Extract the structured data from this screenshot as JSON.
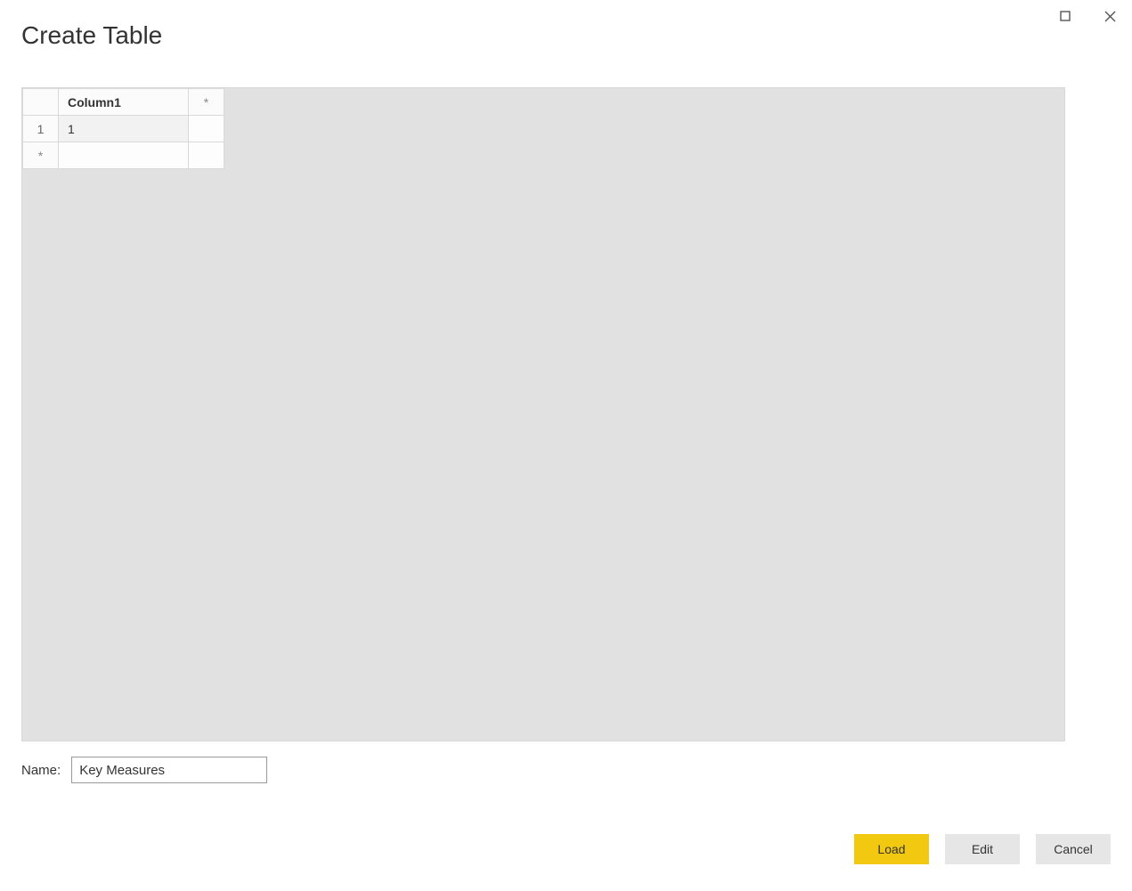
{
  "dialog": {
    "title": "Create Table"
  },
  "grid": {
    "column_header": "Column1",
    "add_column_glyph": "*",
    "add_row_glyph": "*",
    "rows": [
      {
        "index": "1",
        "value": "1"
      }
    ]
  },
  "name_field": {
    "label": "Name:",
    "value": "Key Measures"
  },
  "buttons": {
    "load": "Load",
    "edit": "Edit",
    "cancel": "Cancel"
  }
}
